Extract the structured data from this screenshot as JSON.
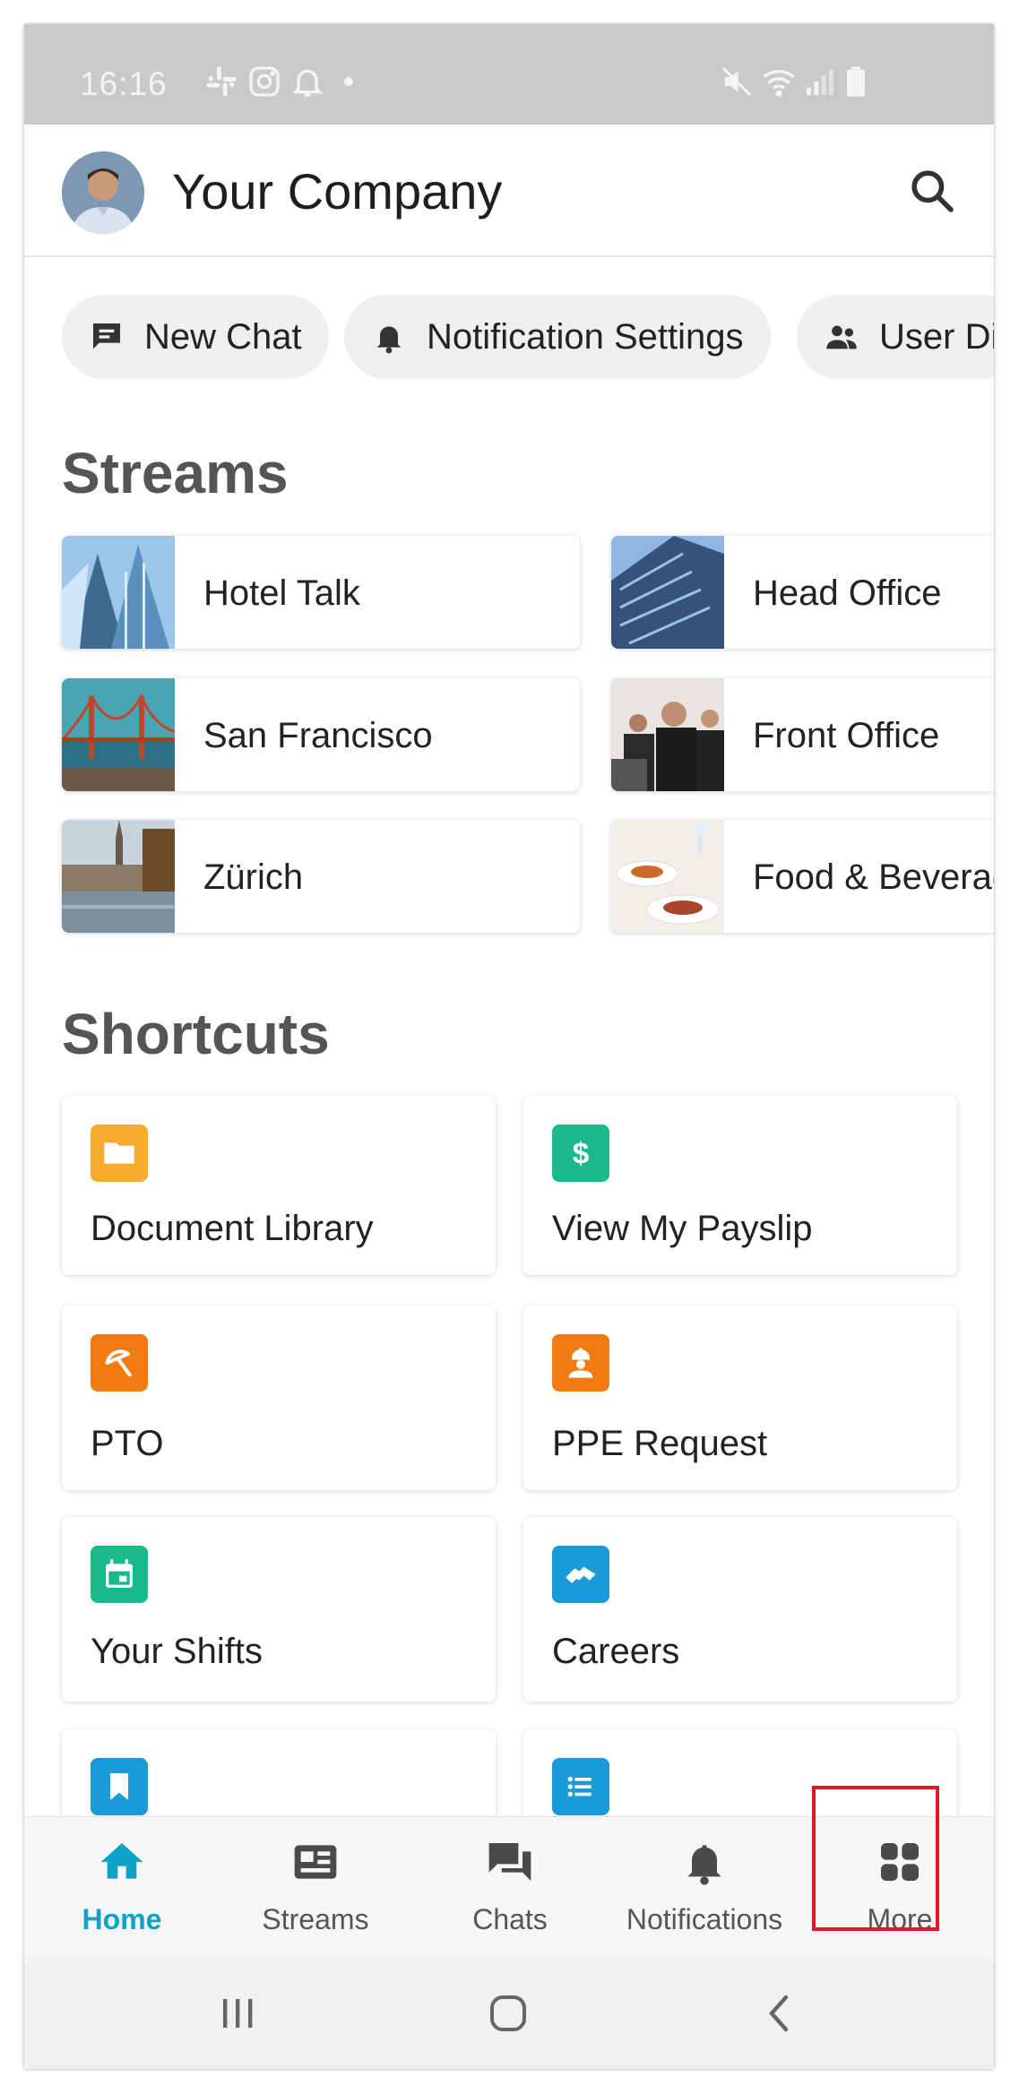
{
  "status_bar": {
    "time": "16:16"
  },
  "header": {
    "company_name": "Your Company"
  },
  "chips": [
    {
      "label": "New Chat",
      "icon": "chat-bubble-icon"
    },
    {
      "label": "Notification Settings",
      "icon": "bell-icon"
    },
    {
      "label": "User Di",
      "icon": "people-icon"
    }
  ],
  "streams": {
    "title": "Streams",
    "items": [
      {
        "label": "Hotel Talk"
      },
      {
        "label": "Head Office"
      },
      {
        "label": "San Francisco"
      },
      {
        "label": "Front Office"
      },
      {
        "label": "Zürich"
      },
      {
        "label": "Food & Beverag"
      }
    ]
  },
  "shortcuts": {
    "title": "Shortcuts",
    "items": [
      {
        "label": "Document Library",
        "icon": "folder-icon",
        "color": "#f7ac2e"
      },
      {
        "label": "View My Payslip",
        "icon": "dollar-icon",
        "color": "#19b98a"
      },
      {
        "label": "PTO",
        "icon": "beach-umbrella-icon",
        "color": "#f07b10"
      },
      {
        "label": "PPE Request",
        "icon": "worker-icon",
        "color": "#f07b10"
      },
      {
        "label": "Your Shifts",
        "icon": "calendar-icon",
        "color": "#19b98a"
      },
      {
        "label": "Careers",
        "icon": "handshake-icon",
        "color": "#1a9ad6"
      },
      {
        "label": "",
        "icon": "bookmark-icon",
        "color": "#1a9ad6"
      },
      {
        "label": "",
        "icon": "list-icon",
        "color": "#1a9ad6"
      }
    ]
  },
  "bottom_nav": [
    {
      "label": "Home",
      "icon": "home-icon",
      "active": true
    },
    {
      "label": "Streams",
      "icon": "newspaper-icon"
    },
    {
      "label": "Chats",
      "icon": "chats-icon"
    },
    {
      "label": "Notifications",
      "icon": "bell-icon"
    },
    {
      "label": "More",
      "icon": "grid-icon"
    }
  ],
  "colors": {
    "accent": "#0ea2c4",
    "highlight": "#e01a22"
  }
}
